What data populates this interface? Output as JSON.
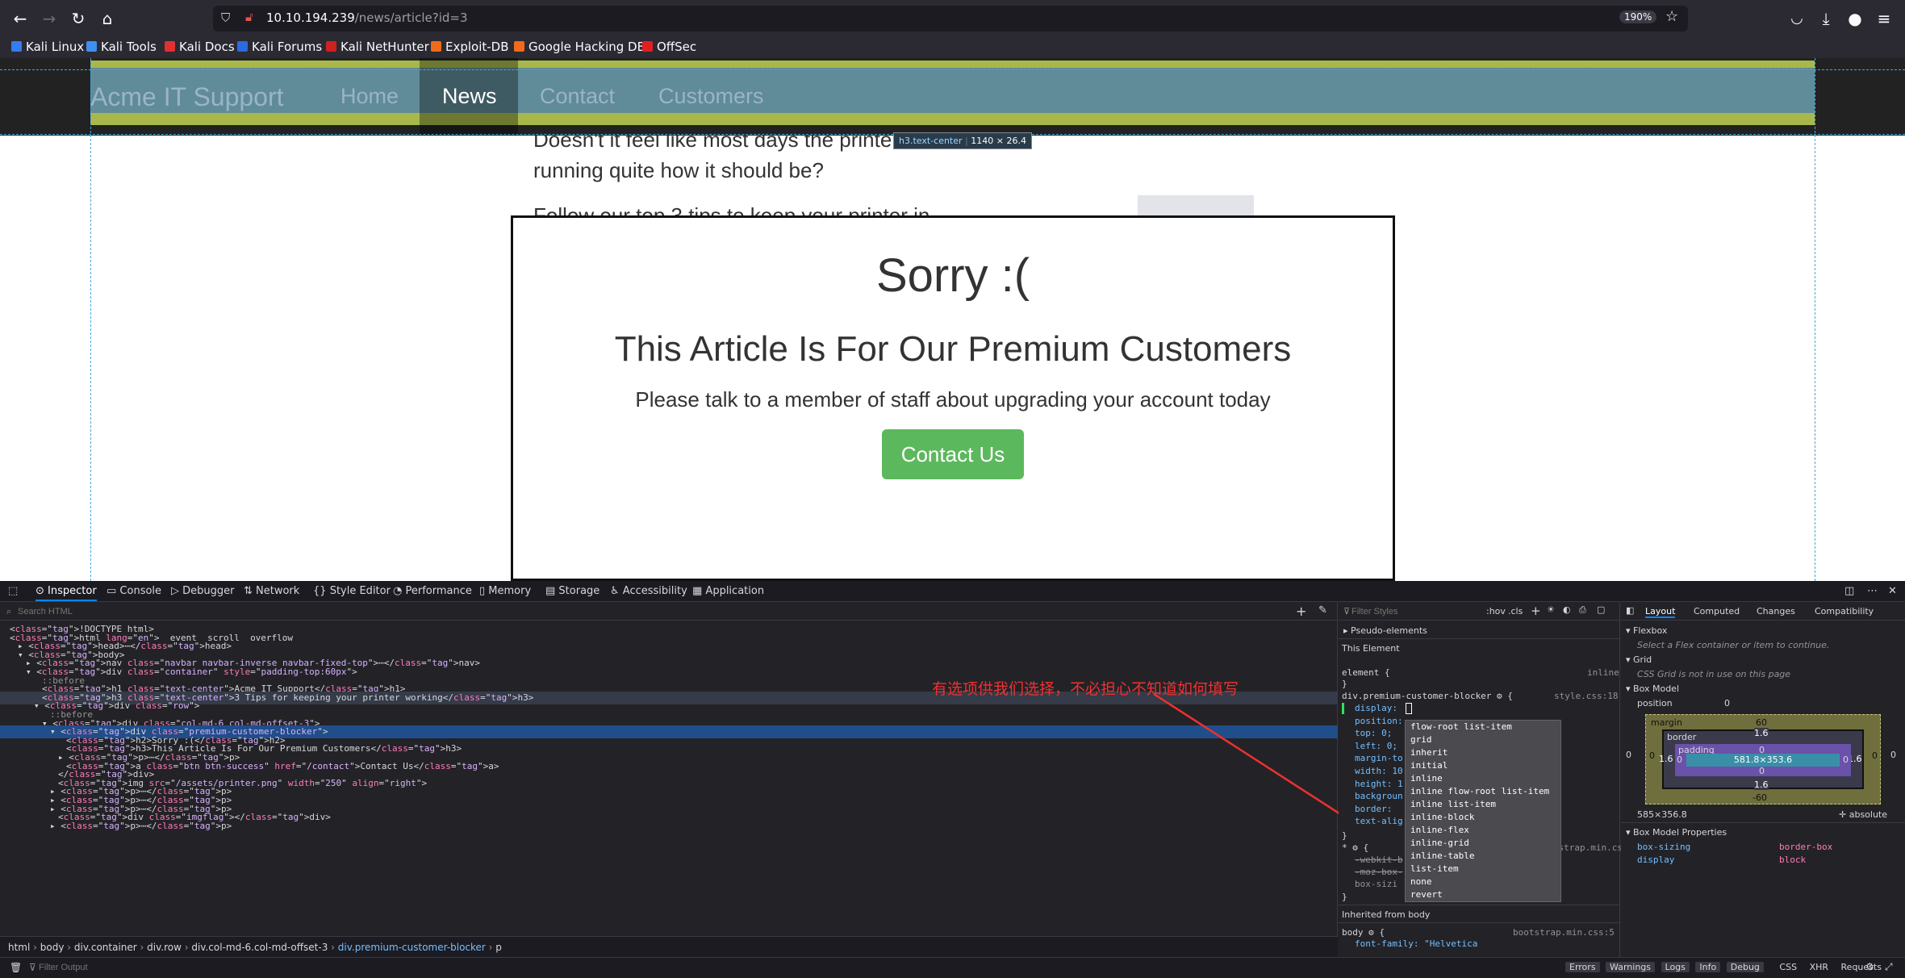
{
  "browser": {
    "url_host": "10.10.194.239",
    "url_path": "/news/article?id=3",
    "zoom": "190%"
  },
  "bookmarks": [
    {
      "label": "Kali Linux",
      "color": "#367bf0"
    },
    {
      "label": "Kali Tools",
      "color": "#3f8ff0"
    },
    {
      "label": "Kali Docs",
      "color": "#e03030"
    },
    {
      "label": "Kali Forums",
      "color": "#2a6be0"
    },
    {
      "label": "Kali NetHunter",
      "color": "#d02020"
    },
    {
      "label": "Exploit-DB",
      "color": "#f06a1a"
    },
    {
      "label": "Google Hacking DB",
      "color": "#f06a1a"
    },
    {
      "label": "OffSec",
      "color": "#e02020"
    }
  ],
  "site": {
    "brand": "Acme IT Support",
    "nav": [
      "Home",
      "News",
      "Contact",
      "Customers"
    ],
    "body_line1": "Doesn't it feel like most days the printe",
    "body_line2": "running quite how it should be?",
    "body_line3": "Follow our top 3 tips to keep your printer in",
    "sorry": "Sorry :(",
    "premium": "This Article Is For Our Premium Customers",
    "talk": "Please talk to a member of staff about upgrading your account today",
    "contact_btn": "Contact Us"
  },
  "tooltip": {
    "selector": "h3.text-center",
    "size": "1140 × 26.4"
  },
  "devtools": {
    "tabs": [
      "Inspector",
      "Console",
      "Debugger",
      "Network",
      "Style Editor",
      "Performance",
      "Memory",
      "Storage",
      "Accessibility",
      "Application"
    ],
    "search_placeholder": "Search HTML",
    "html_lines": [
      {
        "i": 0,
        "t": "<!DOCTYPE html>"
      },
      {
        "i": 0,
        "t": "<html lang=\"en\">  event  scroll  overflow"
      },
      {
        "i": 1,
        "t": "▸ <head>⋯</head>"
      },
      {
        "i": 1,
        "t": "▾ <body>"
      },
      {
        "i": 2,
        "t": "▸ <nav class=\"navbar navbar-inverse navbar-fixed-top\">⋯</nav>"
      },
      {
        "i": 2,
        "t": "▾ <div class=\"container\" style=\"padding-top:60px\">"
      },
      {
        "i": 4,
        "t": "::before"
      },
      {
        "i": 4,
        "t": "<h1 class=\"text-center\">Acme IT Support</h1>"
      },
      {
        "i": 4,
        "t": "<h3 class=\"text-center\">3 Tips for keeping your printer working</h3>"
      },
      {
        "i": 3,
        "t": "▾ <div class=\"row\">"
      },
      {
        "i": 5,
        "t": "::before"
      },
      {
        "i": 4,
        "t": "▾ <div class=\"col-md-6 col-md-offset-3\">"
      },
      {
        "i": 5,
        "t": "▾ <div class=\"premium-customer-blocker\">"
      },
      {
        "i": 7,
        "t": "<h2>Sorry :(</h2>"
      },
      {
        "i": 7,
        "t": "<h3>This Article Is For Our Premium Customers</h3>"
      },
      {
        "i": 6,
        "t": "▸ <p>⋯</p>"
      },
      {
        "i": 7,
        "t": "<a class=\"btn btn-success\" href=\"/contact\">Contact Us</a>"
      },
      {
        "i": 6,
        "t": "</div>"
      },
      {
        "i": 6,
        "t": "<img src=\"/assets/printer.png\" width=\"250\" align=\"right\">"
      },
      {
        "i": 5,
        "t": "▸ <p>⋯</p>"
      },
      {
        "i": 5,
        "t": "▸ <p>⋯</p>"
      },
      {
        "i": 5,
        "t": "▸ <p>⋯</p>"
      },
      {
        "i": 6,
        "t": "<div class=\"imgflag\"></div>"
      },
      {
        "i": 5,
        "t": "▸ <p>⋯</p>"
      }
    ],
    "breadcrumbs": [
      "html",
      "body",
      "div.container",
      "div.row",
      "div.col-md-6.col-md-offset-3",
      "div.premium-customer-blocker",
      "p"
    ],
    "annotation": "有选项供我们选择，不必担心不知道如何填写",
    "rules": {
      "filter_placeholder": "Filter Styles",
      "pseudo": "Pseudo-elements",
      "this_element": "This Element",
      "element_rule": "element {",
      "inline": "inline",
      "selector": "div.premium-customer-blocker",
      "source": "style.css:18",
      "bootstrap": "bootstrap.min.css:5",
      "inherited": "Inherited from body",
      "body_src": "bootstrap.min.css:5",
      "props": [
        "display:",
        "position:",
        "top: 0;",
        "left: 0;",
        "margin-to",
        "width: 10",
        "height: 1",
        "backgroun",
        "border: ",
        "text-alig"
      ],
      "other": [
        "-webkit-b",
        "-moz-box-",
        "box-sizi"
      ],
      "body_font": "font-family: \"Helvetica"
    },
    "display_options": [
      "flow-root list-item",
      "grid",
      "inherit",
      "initial",
      "inline",
      "inline flow-root list-item",
      "inline list-item",
      "inline-block",
      "inline-flex",
      "inline-grid",
      "inline-table",
      "list-item",
      "none",
      "revert"
    ],
    "layout_tabs": [
      "Layout",
      "Computed",
      "Changes",
      "Compatibility"
    ],
    "layout": {
      "flexbox": "Flexbox",
      "flex_msg": "Select a Flex container or item to continue.",
      "grid": "Grid",
      "grid_msg": "CSS Grid is not in use on this page",
      "boxmodel": "Box Model",
      "position": "position",
      "margin": "margin",
      "border": "border",
      "padding": "padding",
      "content": "581.8×353.6",
      "m_top": "60",
      "m_bottom": "-60",
      "b_top": "1.6",
      "b_bottom": "1.6",
      "b_left": "1.6",
      "b_right": "1.6",
      "p_top": "0",
      "p_bottom": "0",
      "p_left": "0",
      "p_right": "0",
      "side": "0",
      "dims": "585×356.8",
      "pos_mode": "absolute",
      "props_title": "Box Model Properties",
      "prop1": "box-sizing",
      "val1": "border-box",
      "prop2": "display",
      "val2": "block"
    },
    "console": {
      "filter": "Filter Output",
      "buttons": [
        "Errors",
        "Warnings",
        "Logs",
        "Info",
        "Debug"
      ],
      "types": [
        "CSS",
        "XHR",
        "Requests"
      ]
    }
  }
}
